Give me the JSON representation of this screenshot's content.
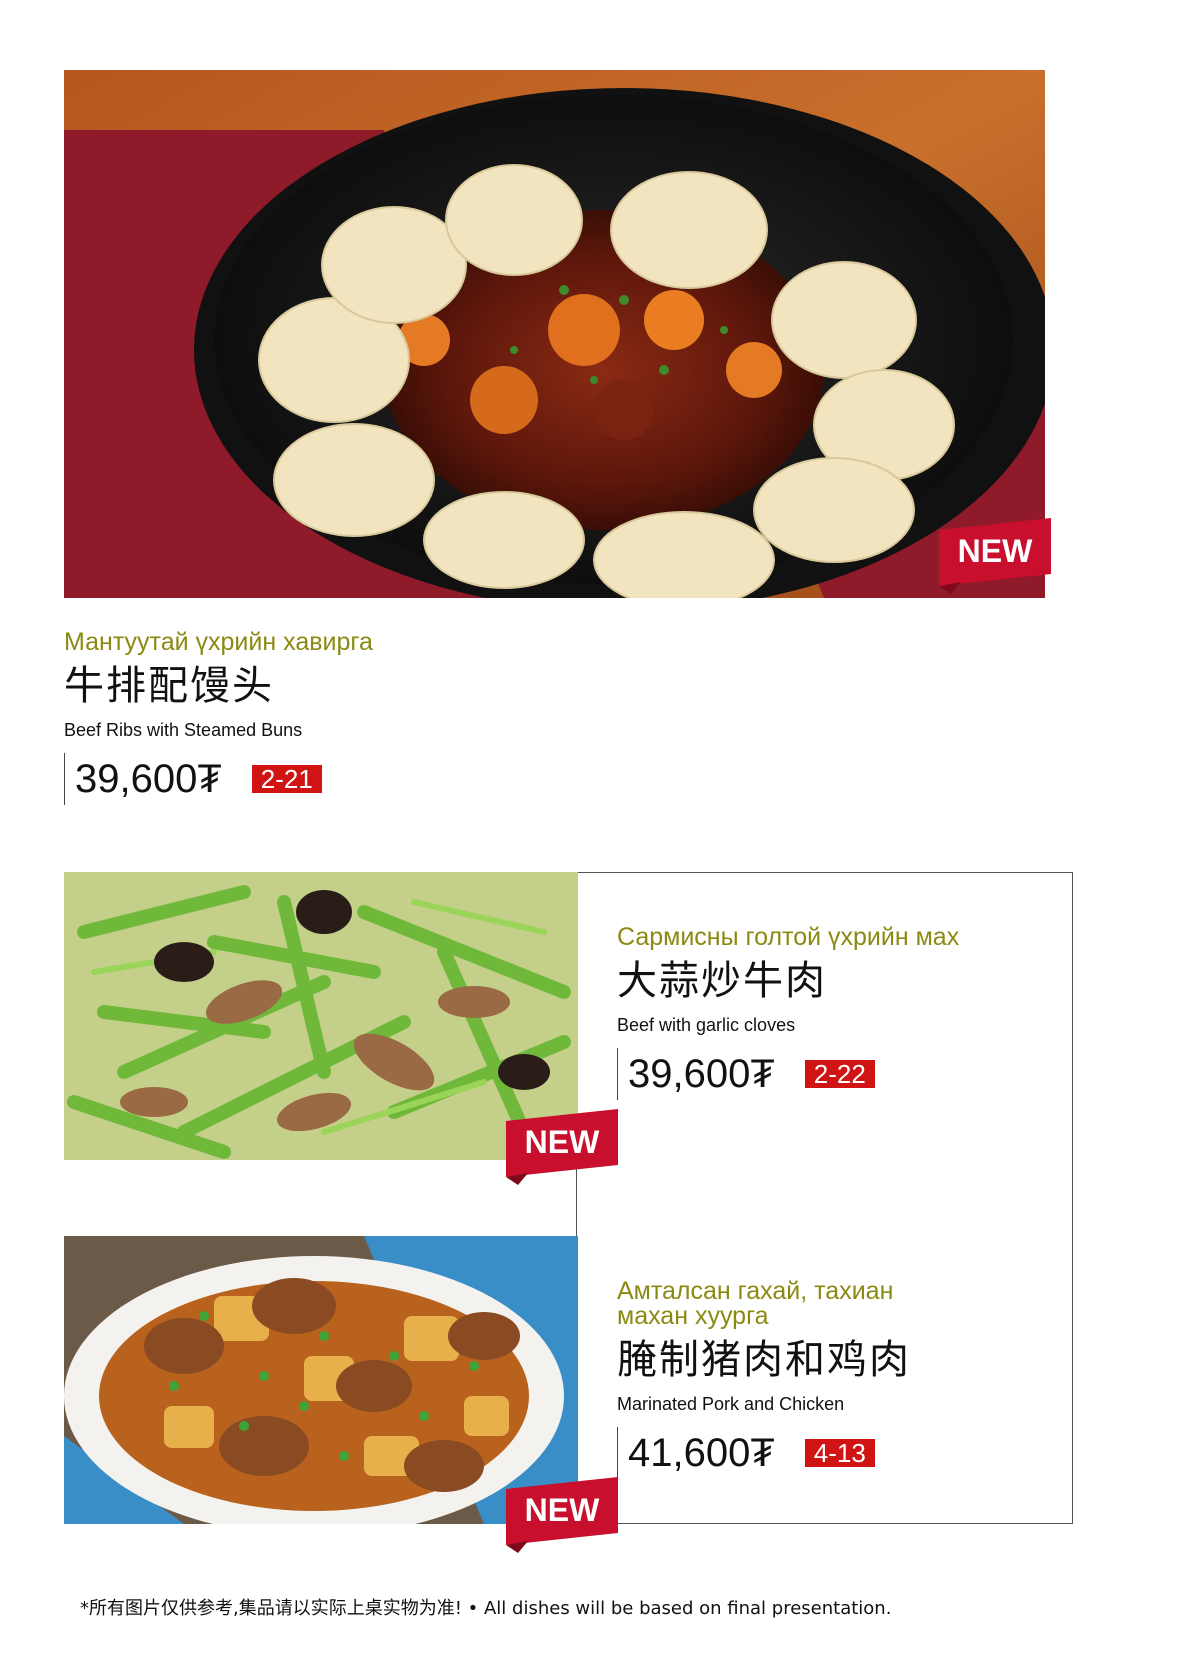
{
  "items": [
    {
      "name_mn": "Мантуутай үхрийн хавирга",
      "name_zh": "牛排配馒头",
      "name_en": "Beef Ribs with Steamed Buns",
      "price": "39,600₮",
      "code": "2-21",
      "badge": "NEW"
    },
    {
      "name_mn": "Сармисны голтой үхрийн мах",
      "name_zh": "大蒜炒牛肉",
      "name_en": "Beef with garlic cloves",
      "price": "39,600₮",
      "code": "2-22",
      "badge": "NEW"
    },
    {
      "name_mn_line1": "Амталсан гахай, тахиан",
      "name_mn_line2": "махан хуурга",
      "name_zh": "腌制猪肉和鸡肉",
      "name_en": "Marinated Pork and Chicken",
      "price": "41,600₮",
      "code": "4-13",
      "badge": "NEW"
    }
  ],
  "footer": {
    "note": "*所有图片仅供参考,集品请以实际上桌实物为准! • All dishes will be based on final presentation."
  },
  "colors": {
    "mongolian_title": "#8a8a12",
    "code_badge": "#d01414",
    "new_ribbon": "#c8102e"
  }
}
